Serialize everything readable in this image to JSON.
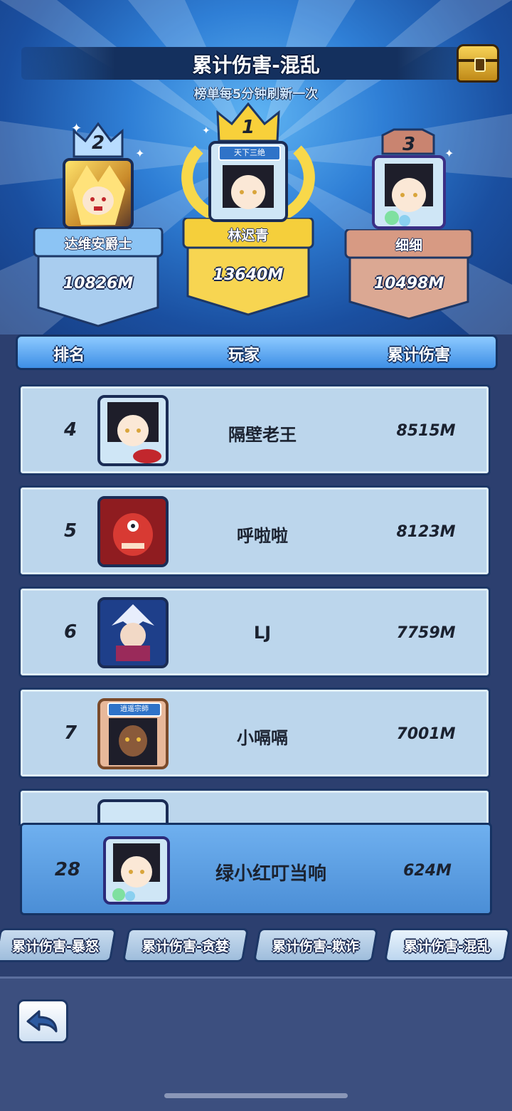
{
  "header": {
    "title": "累计伤害-混乱",
    "subtitle": "榜单每5分钟刷新一次",
    "chest_icon": "treasure-chest-icon"
  },
  "podium": [
    {
      "rank": "2",
      "name": "达维安爵士",
      "damage": "10826M",
      "color": "#7fb6ea"
    },
    {
      "rank": "1",
      "name": "林迟青",
      "damage": "13640M",
      "color": "#f2c63a",
      "badge": "天下三绝"
    },
    {
      "rank": "3",
      "name": "细细",
      "damage": "10498M",
      "color": "#d59a84"
    }
  ],
  "table": {
    "columns": [
      "排名",
      "玩家",
      "累计伤害"
    ],
    "rows": [
      {
        "rank": "4",
        "player": "隔壁老王",
        "damage": "8515M"
      },
      {
        "rank": "5",
        "player": "呼啦啦",
        "damage": "8123M"
      },
      {
        "rank": "6",
        "player": "LJ",
        "damage": "7759M"
      },
      {
        "rank": "7",
        "player": "小嗝嗝",
        "damage": "7001M",
        "badge": "逍遥宗師"
      }
    ]
  },
  "my_rank": {
    "rank": "28",
    "player": "绿小红叮当响",
    "damage": "624M"
  },
  "tabs": [
    "累计伤害-暴怒",
    "累计伤害-贪婪",
    "累计伤害-欺诈",
    "累计伤害-混乱"
  ],
  "active_tab": "累计伤害-混乱",
  "back_icon": "back-arrow-icon"
}
